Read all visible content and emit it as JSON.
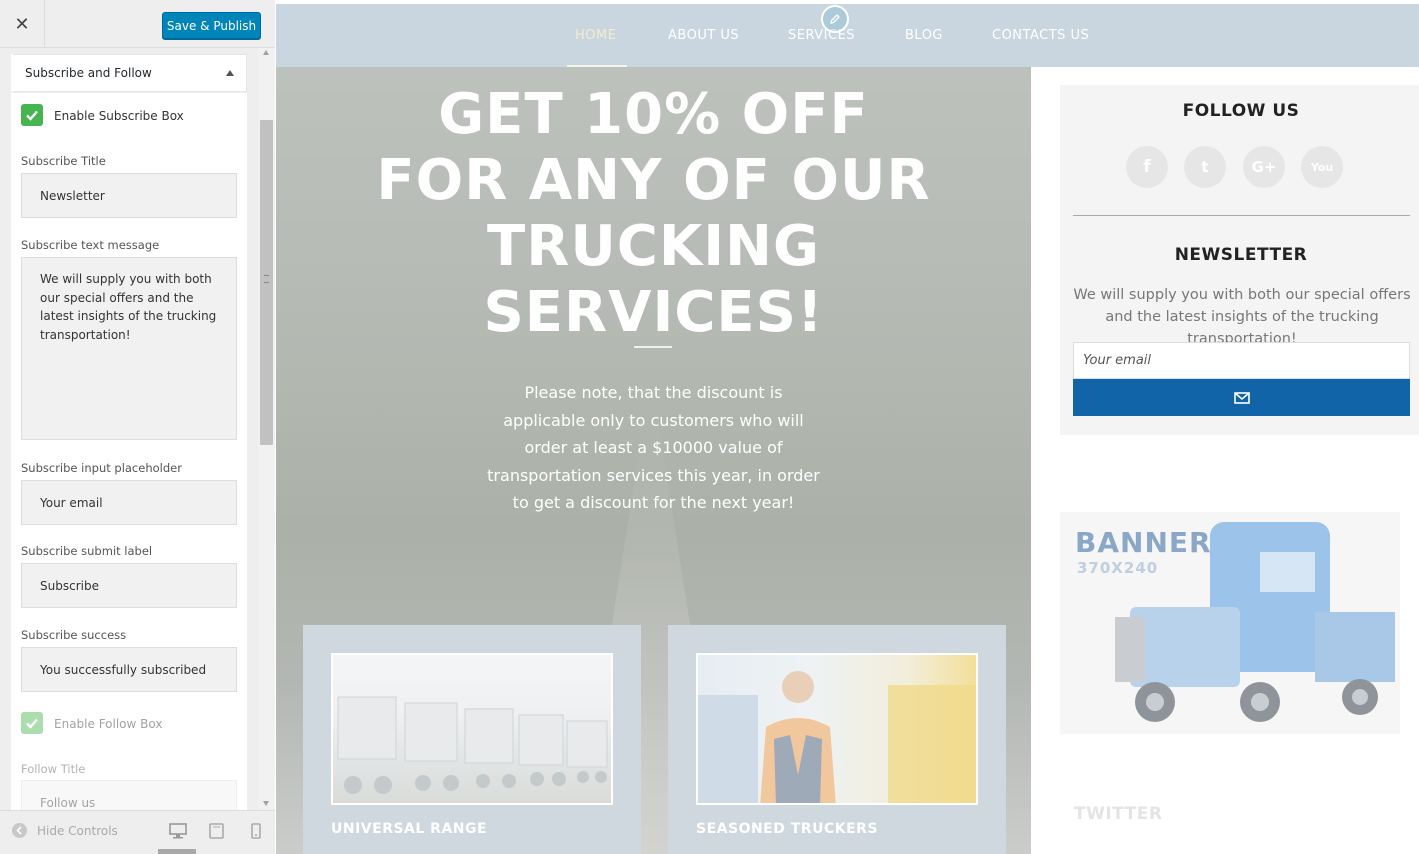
{
  "customizer": {
    "close_label": "✕",
    "publish_label": "Save & Publish",
    "section_title": "Subscribe and Follow",
    "fields": {
      "enable_subscribe_label": "Enable Subscribe Box",
      "subscribe_title_label": "Subscribe Title",
      "subscribe_title_value": "Newsletter",
      "subscribe_text_label": "Subscribe text message",
      "subscribe_text_value": "We will supply you with both our special offers and the latest insights of the trucking transportation!",
      "placeholder_label": "Subscribe input placeholder",
      "placeholder_value": "Your email",
      "submit_label_label": "Subscribe submit label",
      "submit_label_value": "Subscribe",
      "success_label": "Subscribe success",
      "success_value": "You successfully subscribed",
      "enable_follow_label": "Enable Follow Box",
      "follow_title_label": "Follow Title",
      "follow_title_value": "Follow us"
    },
    "footer": {
      "hide_controls_label": "Hide Controls"
    }
  },
  "preview": {
    "nav": {
      "items": [
        "HOME",
        "ABOUT US",
        "SERVICES",
        "BLOG",
        "CONTACTS US"
      ],
      "active": "HOME"
    },
    "hero": {
      "title": "GET 10% OFF FOR ANY OF OUR TRUCKING SERVICES!",
      "text": "Please note, that the discount is applicable only to customers who will order at least a $10000 value of transportation services this year, in order to get a discount for the next year!"
    },
    "cards": [
      {
        "title": "UNIVERSAL RANGE"
      },
      {
        "title": "SEASONED TRUCKERS"
      }
    ],
    "follow": {
      "title": "FOLLOW US",
      "icons": [
        "facebook-icon",
        "twitter-icon",
        "google-plus-icon",
        "youtube-icon"
      ],
      "glyphs": [
        "f",
        "t",
        "G+",
        "You"
      ]
    },
    "newsletter": {
      "title": "NEWSLETTER",
      "text": "We will supply you with both our special offers and the latest insights of the trucking transportation!",
      "placeholder": "Your email"
    },
    "banner": {
      "title": "BANNER",
      "subtitle": "370X240"
    },
    "twitter_title": "TWITTER"
  },
  "colors": {
    "publish": "#0085ba",
    "checkbox": "#46b450",
    "nav_bg": "#c9d6e0",
    "subscribe_button": "#1264a8"
  }
}
